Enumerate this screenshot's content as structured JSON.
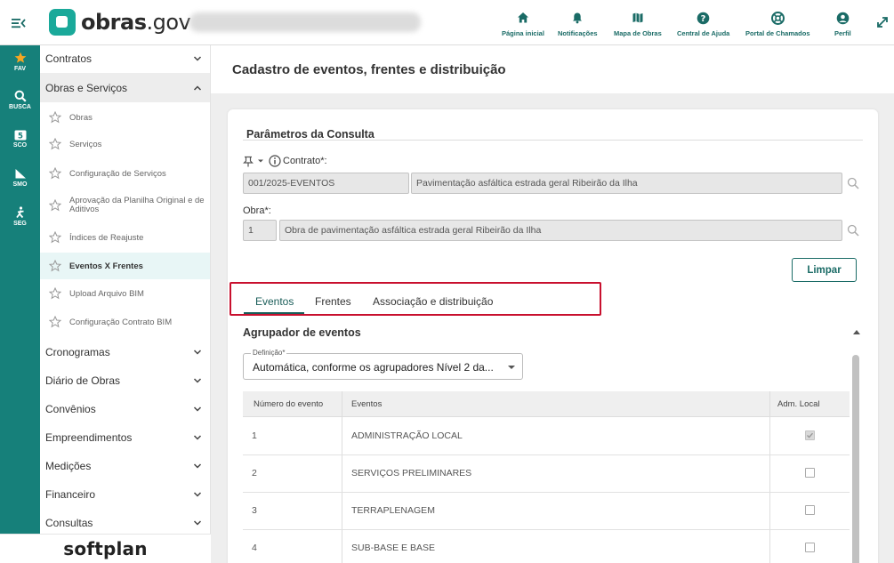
{
  "header": {
    "logo_text_bold": "obras",
    "logo_text_rest": ".gov",
    "nav": [
      {
        "label": "Página inicial",
        "icon": "home-icon"
      },
      {
        "label": "Notificações",
        "icon": "bell-icon"
      },
      {
        "label": "Mapa de Obras",
        "icon": "map-icon"
      },
      {
        "label": "Central de Ajuda",
        "icon": "help-icon"
      },
      {
        "label": "Portal de Chamados",
        "icon": "support-icon"
      },
      {
        "label": "Perfil",
        "icon": "user-icon"
      }
    ]
  },
  "rail": [
    {
      "label": "FAV",
      "icon": "star-icon"
    },
    {
      "label": "BUSCA",
      "icon": "search-icon"
    },
    {
      "label": "SCO",
      "icon": "sco-icon"
    },
    {
      "label": "SMO",
      "icon": "smo-icon"
    },
    {
      "label": "SEG",
      "icon": "seg-icon"
    }
  ],
  "sidebar": {
    "groups_top": [
      {
        "label": "Contratos"
      },
      {
        "label": "Obras e Serviços"
      }
    ],
    "sub_items": [
      {
        "label": "Obras"
      },
      {
        "label": "Serviços"
      },
      {
        "label": "Configuração de Serviços"
      },
      {
        "label": "Aprovação da Planilha Original e de Aditivos"
      },
      {
        "label": "Índices de Reajuste"
      },
      {
        "label": "Eventos X Frentes"
      },
      {
        "label": "Upload Arquivo BIM"
      },
      {
        "label": "Configuração Contrato BIM"
      }
    ],
    "groups_bottom": [
      {
        "label": "Cronogramas"
      },
      {
        "label": "Diário de Obras"
      },
      {
        "label": "Convênios"
      },
      {
        "label": "Empreendimentos"
      },
      {
        "label": "Medições"
      },
      {
        "label": "Financeiro"
      },
      {
        "label": "Consultas"
      }
    ],
    "footer_brand": "softplan"
  },
  "main": {
    "page_title": "Cadastro de eventos, frentes e distribuição",
    "params_title": "Parâmetros da Consulta",
    "contract_label": "Contrato*:",
    "contract_code": "001/2025-EVENTOS",
    "contract_desc": "Pavimentação asfáltica estrada geral Ribeirão da Ilha",
    "obra_label": "Obra*:",
    "obra_code": "1",
    "obra_desc": "Obra de pavimentação asfáltica estrada geral Ribeirão da Ilha",
    "clear_button": "Limpar",
    "tabs": [
      {
        "label": "Eventos"
      },
      {
        "label": "Frentes"
      },
      {
        "label": "Associação e distribuição"
      }
    ],
    "group_title": "Agrupador de eventos",
    "definition_caption": "Definição*",
    "definition_value": "Automática, conforme os agrupadores Nível 2 da...",
    "table": {
      "headers": [
        "Número do evento",
        "Eventos",
        "Adm. Local"
      ],
      "rows": [
        {
          "num": "1",
          "name": "ADMINISTRAÇÃO LOCAL",
          "adm": true
        },
        {
          "num": "2",
          "name": "SERVIÇOS PRELIMINARES",
          "adm": false
        },
        {
          "num": "3",
          "name": "TERRAPLENAGEM",
          "adm": false
        },
        {
          "num": "4",
          "name": "SUB-BASE E BASE",
          "adm": false
        }
      ]
    }
  }
}
